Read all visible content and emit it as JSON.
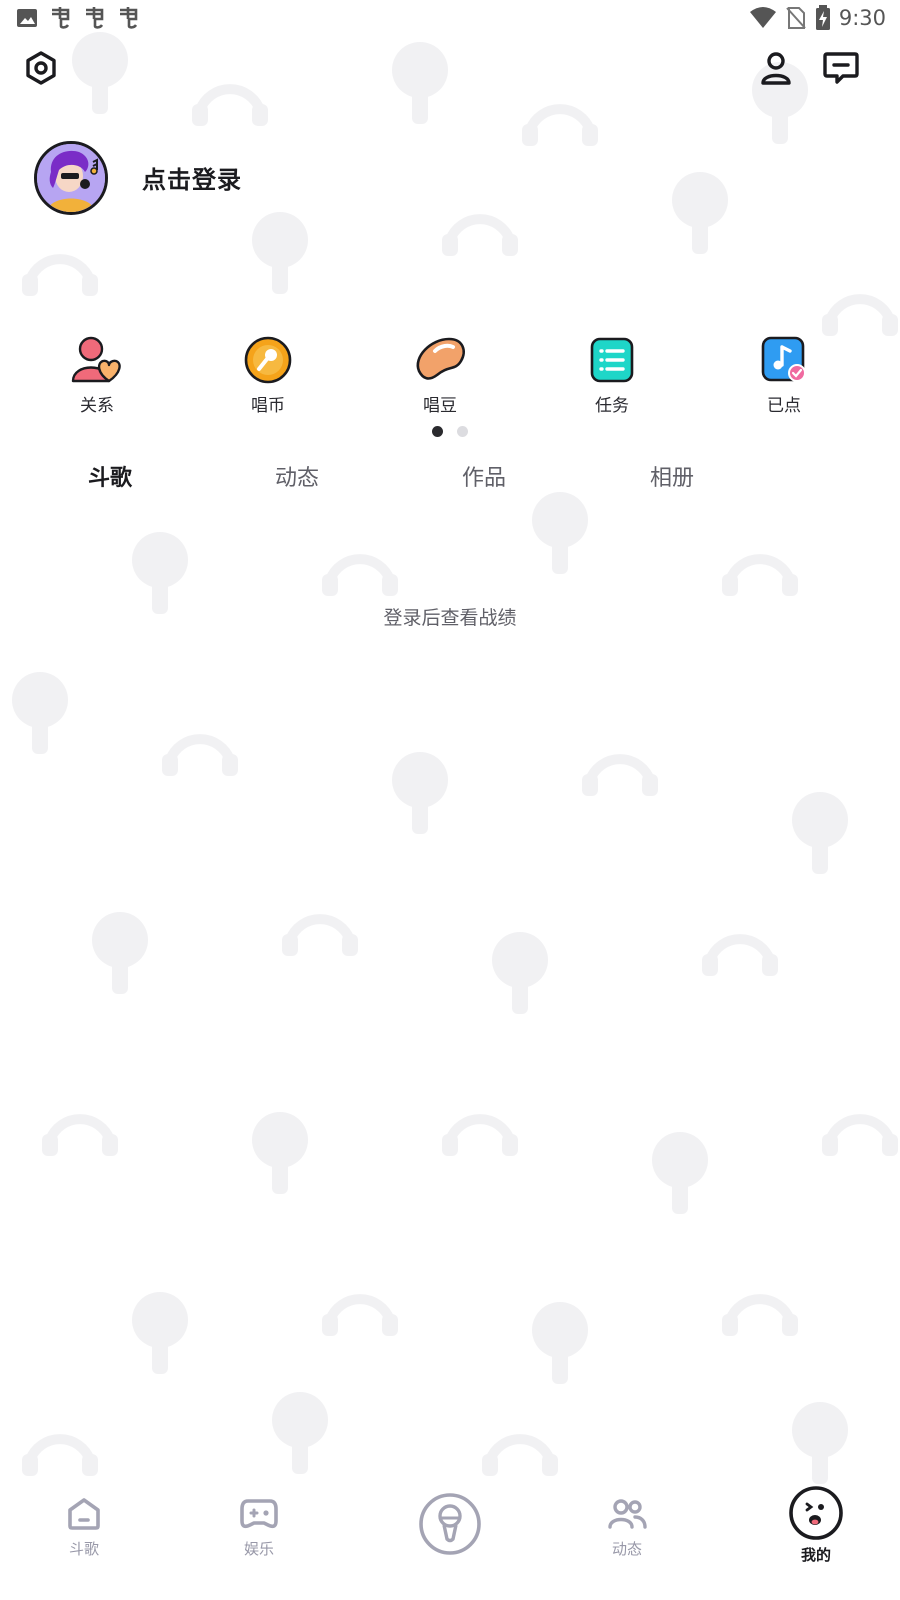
{
  "status_bar": {
    "time": "9:30",
    "left_icons": [
      "image-icon",
      "bug-icon",
      "bug-icon",
      "bug-icon"
    ],
    "right_icons": [
      "wifi-icon",
      "no-sim-icon",
      "battery-charging-icon"
    ]
  },
  "top_bar": {
    "left_icon": "settings-icon",
    "right_icons": [
      "user-icon",
      "message-icon"
    ]
  },
  "profile": {
    "login_label": "点击登录"
  },
  "quick_actions": [
    {
      "label": "关系",
      "icon": "relationship-icon"
    },
    {
      "label": "唱币",
      "icon": "coin-icon"
    },
    {
      "label": "唱豆",
      "icon": "bean-icon"
    },
    {
      "label": "任务",
      "icon": "task-icon"
    },
    {
      "label": "已点",
      "icon": "music-note-icon"
    }
  ],
  "pager": {
    "pages": 2,
    "active": 0
  },
  "tabs": [
    {
      "label": "斗歌",
      "active": true
    },
    {
      "label": "动态",
      "active": false
    },
    {
      "label": "作品",
      "active": false
    },
    {
      "label": "相册",
      "active": false
    }
  ],
  "empty_state": {
    "message": "登录后查看战绩"
  },
  "bottom_nav": [
    {
      "label": "斗歌",
      "icon": "home-icon",
      "active": false
    },
    {
      "label": "娱乐",
      "icon": "gamepad-icon",
      "active": false
    },
    {
      "label": "",
      "icon": "microphone-icon",
      "active": false
    },
    {
      "label": "动态",
      "icon": "people-icon",
      "active": false
    },
    {
      "label": "我的",
      "icon": "face-icon",
      "active": true
    }
  ],
  "colors": {
    "text_primary": "#1b1b1f",
    "text_secondary": "#606068",
    "nav_inactive": "#9898a8",
    "coin_orange": "#f5a31a",
    "bean_orange": "#f2a26a",
    "task_teal": "#1ed6c8",
    "music_blue": "#2f9cf2",
    "relation_pink": "#f06a7a"
  }
}
